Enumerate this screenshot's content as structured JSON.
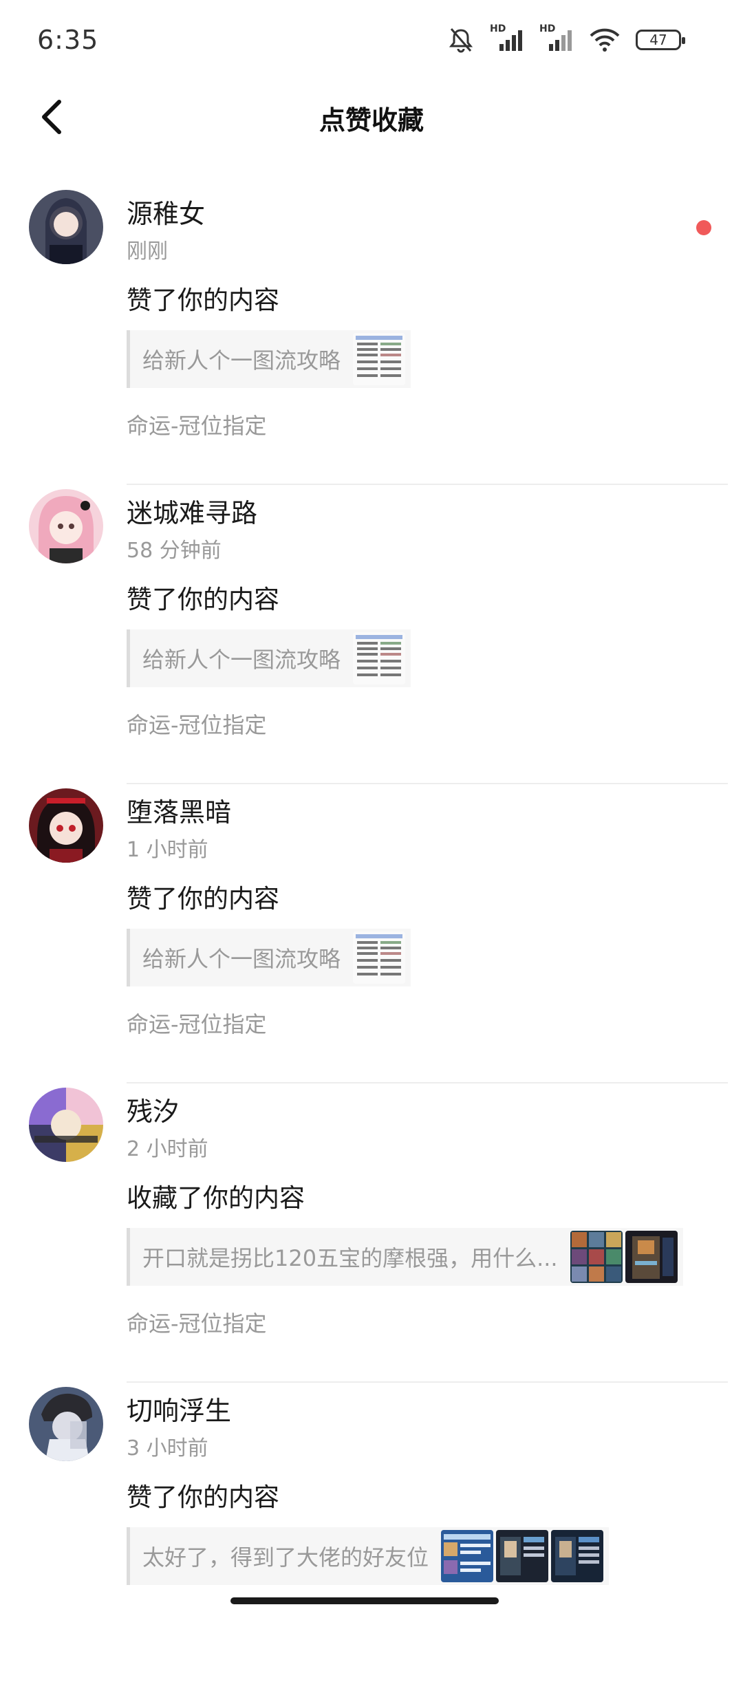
{
  "status_bar": {
    "time": "6:35",
    "battery": "47",
    "signal_label": "HD",
    "icons": [
      "bell-muted-icon",
      "signal-hd-icon",
      "signal-hd-icon",
      "wifi-icon",
      "battery-icon"
    ]
  },
  "header": {
    "title": "点赞收藏",
    "back_icon": "chevron-left-icon"
  },
  "colors": {
    "unread_dot": "#f05a5a",
    "secondary_text": "#999999",
    "quote_bg": "#f6f6f6"
  },
  "notifications": [
    {
      "username": "源稚女",
      "time": "刚刚",
      "action": "赞了你的内容",
      "quote": "给新人个一图流攻略",
      "tag": "命运-冠位指定",
      "unread": true
    },
    {
      "username": "迷城难寻路",
      "time": "58 分钟前",
      "action": "赞了你的内容",
      "quote": "给新人个一图流攻略",
      "tag": "命运-冠位指定",
      "unread": false
    },
    {
      "username": "堕落黑暗",
      "time": "1 小时前",
      "action": "赞了你的内容",
      "quote": "给新人个一图流攻略",
      "tag": "命运-冠位指定",
      "unread": false
    },
    {
      "username": "残汐",
      "time": "2 小时前",
      "action": "收藏了你的内容",
      "quote": "开口就是拐比120五宝的摩根强，用什么...",
      "tag": "命运-冠位指定",
      "unread": false
    },
    {
      "username": "切响浮生",
      "time": "3 小时前",
      "action": "赞了你的内容",
      "quote": "太好了，得到了大佬的好友位",
      "tag": "",
      "unread": false
    }
  ]
}
